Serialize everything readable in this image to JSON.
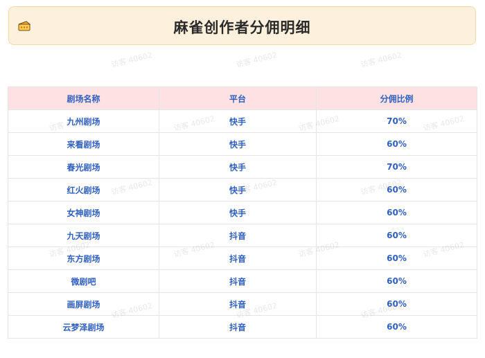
{
  "header": {
    "title": "麻雀创作者分佣明细",
    "logo_icon": "cheese-wallet-icon"
  },
  "table": {
    "columns": [
      "剧场名称",
      "平台",
      "分佣比例"
    ],
    "rows": [
      [
        "九州剧场",
        "快手",
        "70%"
      ],
      [
        "来看剧场",
        "快手",
        "60%"
      ],
      [
        "春光剧场",
        "快手",
        "70%"
      ],
      [
        "红火剧场",
        "快手",
        "60%"
      ],
      [
        "女神剧场",
        "快手",
        "60%"
      ],
      [
        "九天剧场",
        "抖音",
        "60%"
      ],
      [
        "东方剧场",
        "抖音",
        "60%"
      ],
      [
        "微剧吧",
        "抖音",
        "60%"
      ],
      [
        "画屏剧场",
        "抖音",
        "60%"
      ],
      [
        "云梦泽剧场",
        "抖音",
        "60%"
      ]
    ]
  },
  "watermark": "访客 40602",
  "colors": {
    "header_bg": "#fdf1dd",
    "header_border": "#f3d9a9",
    "table_head_bg": "#fde1e3",
    "cell_text": "#2f5fbf"
  }
}
